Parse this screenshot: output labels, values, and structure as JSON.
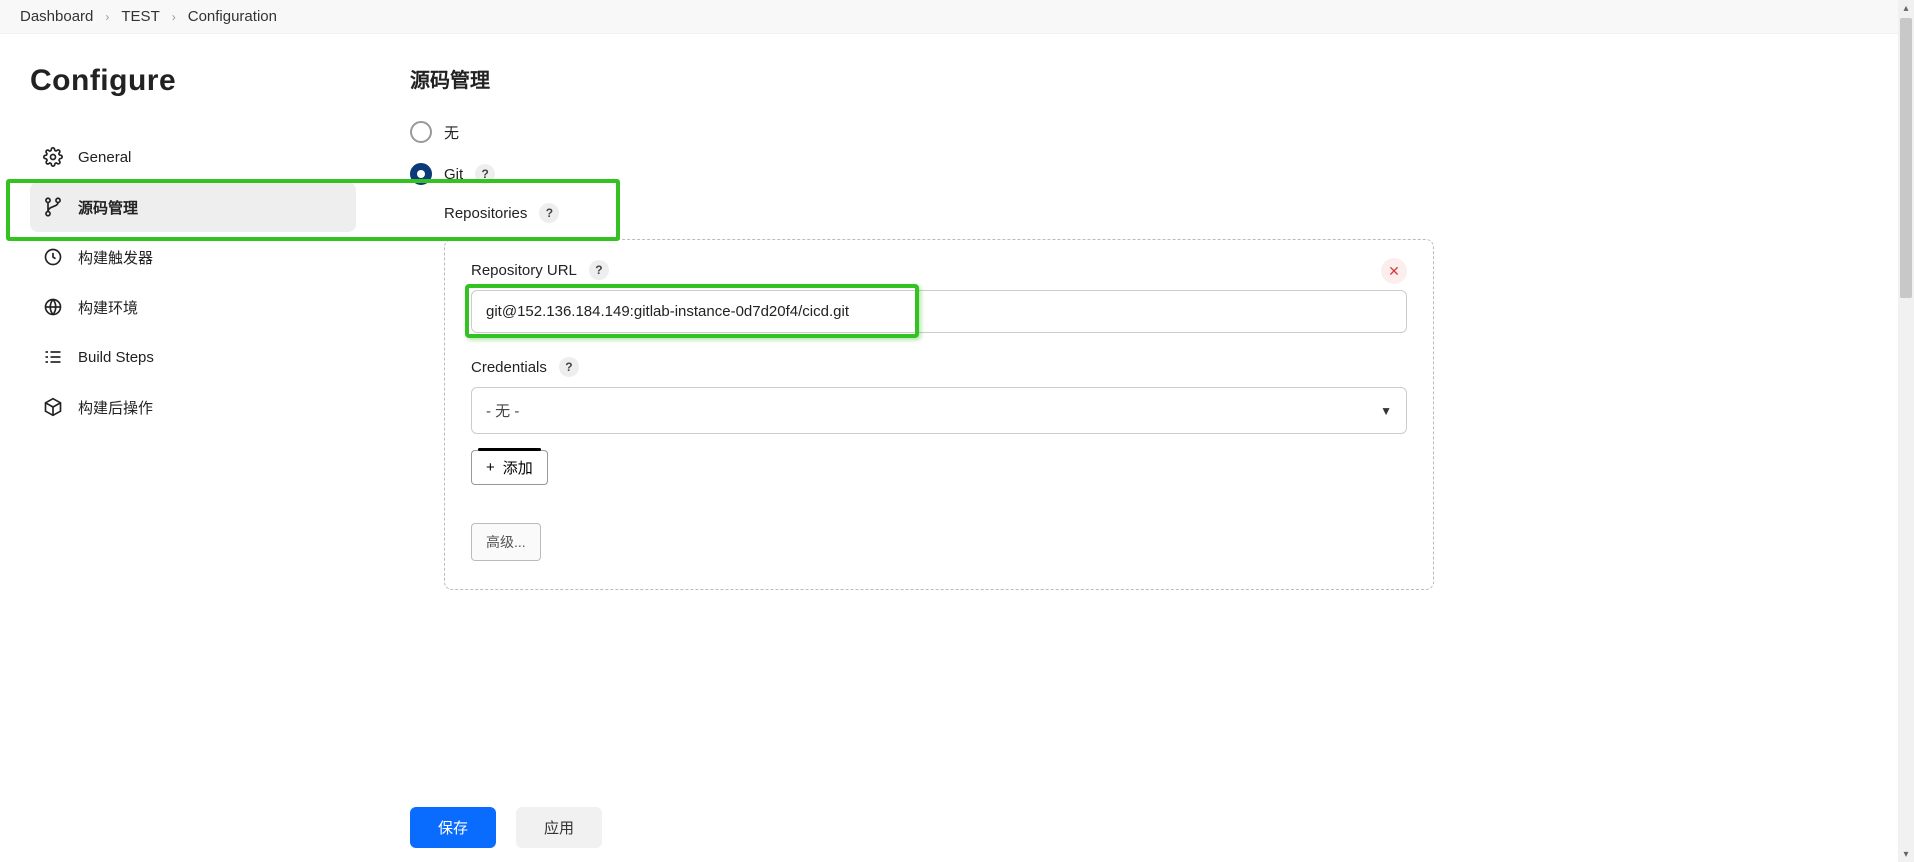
{
  "breadcrumb": {
    "items": [
      "Dashboard",
      "TEST",
      "Configuration"
    ]
  },
  "sidebar": {
    "title": "Configure",
    "items": [
      {
        "label": "General"
      },
      {
        "label": "源码管理"
      },
      {
        "label": "构建触发器"
      },
      {
        "label": "构建环境"
      },
      {
        "label": "Build Steps"
      },
      {
        "label": "构建后操作"
      }
    ]
  },
  "main": {
    "heading": "源码管理",
    "scm": {
      "none_label": "无",
      "git_label": "Git",
      "repositories_label": "Repositories",
      "repo_url_label": "Repository URL",
      "repo_url_value": "git@152.136.184.149:gitlab-instance-0d7d20f4/cicd.git",
      "credentials_label": "Credentials",
      "credentials_value": "- 无 -",
      "add_label": "添加",
      "advanced_label": "高级..."
    }
  },
  "footer": {
    "save": "保存",
    "apply": "应用"
  },
  "icons": {
    "help": "?",
    "plus": "+",
    "close": "✕",
    "sep": "›"
  }
}
